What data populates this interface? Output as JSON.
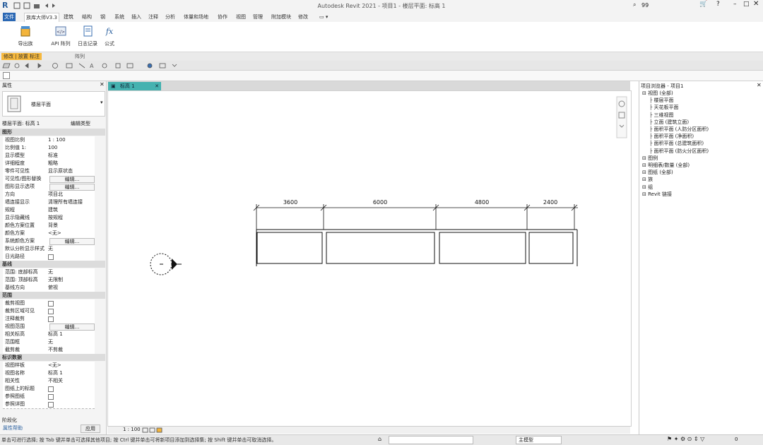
{
  "app": {
    "title": "Autodesk Revit 2021 - 项目1 - 楼层平面: 标高 1",
    "logo_letter": "R",
    "user": "99",
    "window_controls": [
      "minimize-icon",
      "maximize-icon",
      "close-icon"
    ]
  },
  "ribbon": {
    "tabs": [
      "文件",
      "建筑",
      "结构",
      "钢",
      "系统",
      "插入",
      "注释",
      "分析",
      "体量和场地",
      "协作",
      "视图",
      "管理",
      "附加模块",
      "修改"
    ],
    "active_tab": "族库大师V3.3",
    "buttons": [
      {
        "label": "导出族",
        "icon": "box-icon"
      },
      {
        "label": "API 阵列",
        "icon": "api-icon"
      },
      {
        "label": "日志记录",
        "icon": "doc-icon"
      },
      {
        "label": "公式",
        "icon": "fx-icon"
      }
    ],
    "context_tab": "修改 | 放置 标注",
    "panel_label": "阵列"
  },
  "properties": {
    "title": "属性",
    "type_name": "楼层平面",
    "selector": "楼层平面: 标高 1",
    "edit_type": "编辑类型",
    "sections": [
      {
        "name": "图形",
        "rows": [
          {
            "k": "视图比例",
            "v": "1 : 100"
          },
          {
            "k": "比例值 1:",
            "v": "100"
          },
          {
            "k": "显示模型",
            "v": "标准"
          },
          {
            "k": "详细程度",
            "v": "粗略"
          },
          {
            "k": "零件可见性",
            "v": "显示原状态"
          },
          {
            "k": "可见性/图形替换",
            "v": "编辑..."
          },
          {
            "k": "图形显示选项",
            "v": "编辑..."
          },
          {
            "k": "方向",
            "v": "项目北"
          },
          {
            "k": "墙连接显示",
            "v": "清理所有墙连接"
          },
          {
            "k": "规程",
            "v": "建筑"
          },
          {
            "k": "显示隐藏线",
            "v": "按规程"
          },
          {
            "k": "颜色方案位置",
            "v": "背景"
          },
          {
            "k": "颜色方案",
            "v": "<无>"
          },
          {
            "k": "系统颜色方案",
            "v": "编辑..."
          },
          {
            "k": "默认分析显示样式",
            "v": "无"
          },
          {
            "k": "日光路径",
            "v": ""
          }
        ]
      },
      {
        "name": "基线",
        "rows": [
          {
            "k": "范围: 底部标高",
            "v": "无"
          },
          {
            "k": "范围: 顶部标高",
            "v": "无限制"
          },
          {
            "k": "基线方向",
            "v": "俯视"
          }
        ]
      },
      {
        "name": "范围",
        "rows": [
          {
            "k": "裁剪视图",
            "v": ""
          },
          {
            "k": "裁剪区域可见",
            "v": ""
          },
          {
            "k": "注释裁剪",
            "v": ""
          },
          {
            "k": "视图范围",
            "v": "编辑..."
          },
          {
            "k": "相关标高",
            "v": "标高 1"
          },
          {
            "k": "范围框",
            "v": "无"
          },
          {
            "k": "截剪裁",
            "v": "不剪裁"
          }
        ]
      },
      {
        "name": "标识数据",
        "rows": [
          {
            "k": "视图样板",
            "v": "<无>"
          },
          {
            "k": "视图名称",
            "v": "标高 1"
          },
          {
            "k": "相关性",
            "v": "不相关"
          },
          {
            "k": "图纸上的标题",
            "v": ""
          },
          {
            "k": "参照图纸",
            "v": ""
          },
          {
            "k": "参照详图",
            "v": ""
          }
        ]
      }
    ],
    "phase_label": "阶段化",
    "help_link": "属性帮助",
    "apply": "应用"
  },
  "view": {
    "tab_label": "标高 1",
    "scale_label": "1 : 100",
    "dimensions": [
      "3600",
      "6000",
      "4800",
      "2400"
    ]
  },
  "browser": {
    "title": "项目浏览器 - 项目1",
    "nodes": [
      {
        "label": "视图 (全部)",
        "level": 0
      },
      {
        "label": "楼层平面",
        "level": 1
      },
      {
        "label": "天花板平面",
        "level": 1
      },
      {
        "label": "三维视图",
        "level": 1
      },
      {
        "label": "立面 (建筑立面)",
        "level": 1
      },
      {
        "label": "面积平面 (人防分区面积)",
        "level": 1
      },
      {
        "label": "面积平面 (净面积)",
        "level": 1
      },
      {
        "label": "面积平面 (总建筑面积)",
        "level": 1
      },
      {
        "label": "面积平面 (防火分区面积)",
        "level": 1
      },
      {
        "label": "图例",
        "level": 0
      },
      {
        "label": "明细表/数量 (全部)",
        "level": 0
      },
      {
        "label": "图纸 (全部)",
        "level": 0
      },
      {
        "label": "族",
        "level": 0
      },
      {
        "label": "组",
        "level": 0
      },
      {
        "label": "Revit 链接",
        "level": 0
      }
    ]
  },
  "status": {
    "message": "单击可进行选择; 按 Tab 键并单击可选择其他项目; 按 Ctrl 键并单击可将新项目添加到选择集; 按 Shift 键并单击可取消选择。",
    "model": "主模型",
    "zoom": "0"
  }
}
